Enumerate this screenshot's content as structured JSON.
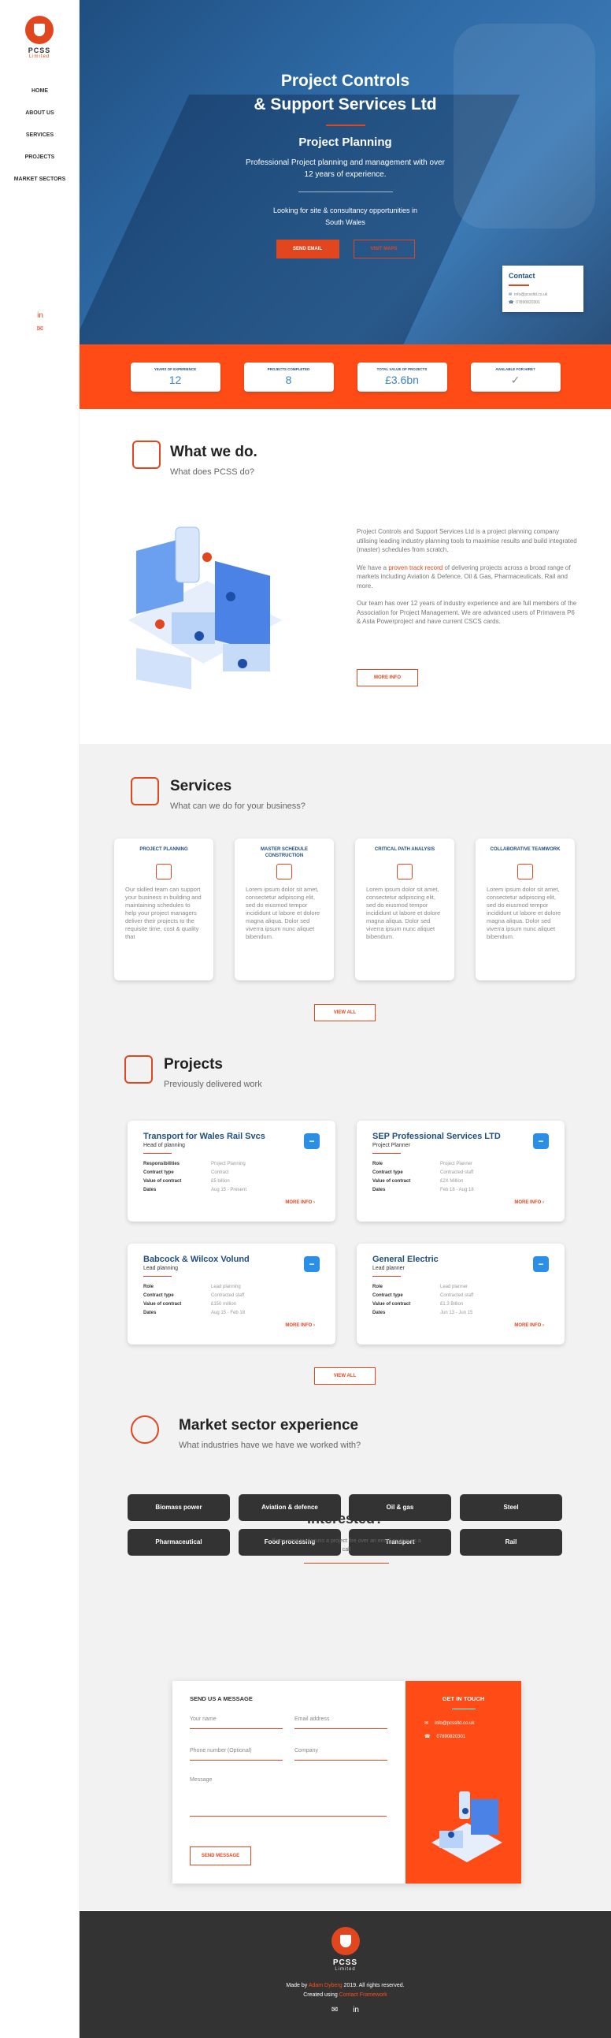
{
  "brand": {
    "name": "PCSS",
    "sub": "Limited"
  },
  "nav": [
    "HOME",
    "ABOUT US",
    "SERVICES",
    "PROJECTS",
    "MARKET SECTORS"
  ],
  "side_social": [
    "in",
    "✉"
  ],
  "hero": {
    "title1": "Project Controls",
    "title2": "& Support Services Ltd",
    "subtitle": "Project Planning",
    "desc": "Professional Project planning and management with over 12 years of experience.",
    "looking": "Looking for site & consultancy opportunities in South Wales",
    "btn_send": "SEND EMAIL",
    "btn_visit": "VISIT MAPS"
  },
  "contact_card": {
    "title": "Contact",
    "email": "info@pcssltd.co.uk",
    "phone": "07890820301"
  },
  "stats": [
    {
      "label": "YEARS OF EXPERIENCE",
      "value": "12"
    },
    {
      "label": "PROJECTS COMPLETED",
      "value": "8"
    },
    {
      "label": "TOTAL VALUE OF PROJECTS",
      "value": "£3.6bn"
    },
    {
      "label": "AVAILABLE FOR HIRE?",
      "value": "✓"
    }
  ],
  "what": {
    "title": "What we do.",
    "sub": "What does PCSS do?",
    "p1": "Project Controls and Support Services Ltd is a project planning company utilising leading industry planning tools to maximise results and build integrated (master) schedules from scratch.",
    "p2a": "We have a ",
    "p2hl": "proven track record",
    "p2b": " of delivering projects across a broad range of markets including Aviation & Defence, Oil & Gas, Pharmaceuticals, Rail and more.",
    "p3": "Our team has over 12 years of industry experience and are full members of the Association for Project Management. We are advanced users of Primavera P6 & Asta Powerproject and have current CSCS cards.",
    "btn": "MORE INFO"
  },
  "services": {
    "title": "Services",
    "sub": "What can we do for your business?",
    "cards": [
      {
        "title": "PROJECT PLANNING",
        "text": "Our skilled team can support your business in building and maintaining schedules to help your project managers deliver their projects to the requisite time, cost & quality that"
      },
      {
        "title": "MASTER SCHEDULE CONSTRUCTION",
        "text": "Lorem ipsum dolor sit amet, consectetur adipiscing elit, sed do eiusmod tempor incididunt ut labore et dolore magna aliqua. Dolor sed viverra ipsum nunc aliquet bibendum."
      },
      {
        "title": "CRITICAL PATH ANALYSIS",
        "text": "Lorem ipsum dolor sit amet, consectetur adipiscing elit, sed do eiusmod tempor incididunt ut labore et dolore magna aliqua. Dolor sed viverra ipsum nunc aliquet bibendum."
      },
      {
        "title": "COLLABORATIVE TEAMWORK",
        "text": "Lorem ipsum dolor sit amet, consectetur adipiscing elit, sed do eiusmod tempor incididunt ut labore et dolore magna aliqua. Dolor sed viverra ipsum nunc aliquet bibendum."
      }
    ],
    "btn": "VIEW ALL"
  },
  "projects": {
    "title": "Projects",
    "sub": "Previously delivered work",
    "more": "MORE INFO ›",
    "btn": "VIEW ALL",
    "cards": [
      {
        "title": "Transport for Wales Rail Svcs",
        "role": "Head of planning",
        "rows": [
          [
            "Responsibilities",
            "Project Planning"
          ],
          [
            "Contract type",
            "Contract"
          ],
          [
            "Value of contract",
            "£5 billion"
          ],
          [
            "Dates",
            "Aug 15 - Present"
          ]
        ]
      },
      {
        "title": "SEP Professional Services LTD",
        "role": "Project Planner",
        "rows": [
          [
            "Role",
            "Project Planner"
          ],
          [
            "Contract type",
            "Contracted staff"
          ],
          [
            "Value of contract",
            "£2X Million"
          ],
          [
            "Dates",
            "Feb 18 - Aug 18"
          ]
        ]
      },
      {
        "title": "Babcock & Wilcox Volund",
        "role": "Lead planning",
        "rows": [
          [
            "Role",
            "Lead planning"
          ],
          [
            "Contract type",
            "Contracted staff"
          ],
          [
            "Value of contract",
            "£150 million"
          ],
          [
            "Dates",
            "Aug 15 - Feb 18"
          ]
        ]
      },
      {
        "title": "General Electric",
        "role": "Lead planner",
        "rows": [
          [
            "Role",
            "Lead planner"
          ],
          [
            "Contract type",
            "Contracted staff"
          ],
          [
            "Value of contract",
            "£1.3 Billion"
          ],
          [
            "Dates",
            "Jun 13 - Jun 15"
          ]
        ]
      }
    ]
  },
  "markets": {
    "title": "Market sector experience",
    "sub": "What industries have we have we worked with?",
    "items": [
      "Biomass power",
      "Aviation & defence",
      "Oil & gas",
      "Steel",
      "Pharmaceutical",
      "Food processing",
      "Transport",
      "Rail"
    ]
  },
  "interested": {
    "title": "Interested?",
    "sub": "If you want to discuss a project fire over an email or give us a call"
  },
  "form": {
    "head": "SEND US A MESSAGE",
    "name": "Your name",
    "email": "Email address",
    "phone": "Phone number (Optional)",
    "company": "Company",
    "message": "Message",
    "btn": "SEND MESSAGE",
    "gt_title": "GET IN TOUCH",
    "gt_email": "info@pcssltd.co.uk",
    "gt_phone": "07890820301"
  },
  "footer": {
    "made_a": "Made by ",
    "made_hl": "Adam Dyberg",
    "made_b": " 2019. All rights reserved.",
    "created_a": "Created using ",
    "created_hl": "Contact Framework",
    "social": [
      "✉",
      "in"
    ]
  }
}
